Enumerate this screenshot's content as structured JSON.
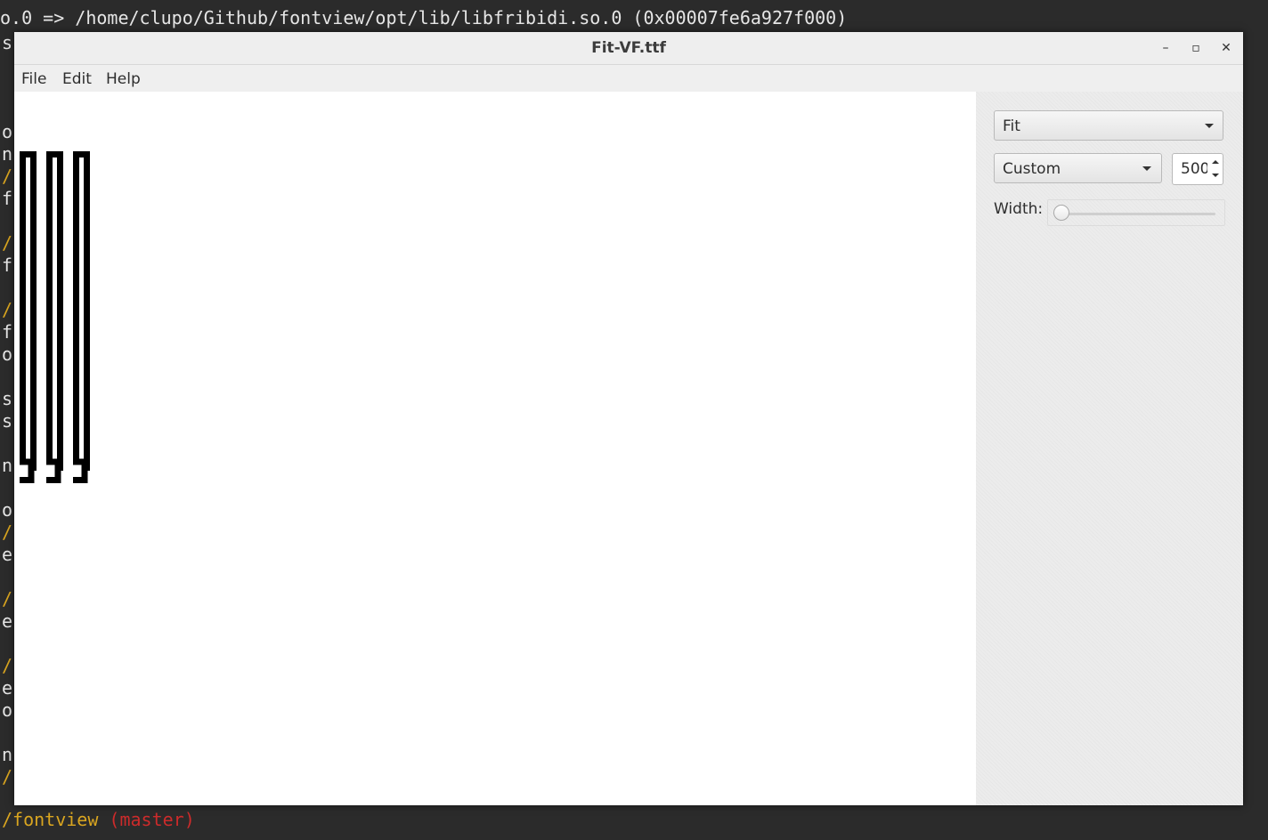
{
  "terminal": {
    "top_line": "o.0 => /home/clupo/Github/fontview/opt/lib/libfribidi.so.0 (0x00007fe6a927f000)",
    "left_fragments": [
      {
        "text": "s",
        "yellow": false
      },
      {
        "text": "o",
        "yellow": false
      },
      {
        "text": "n",
        "yellow": false
      },
      {
        "text": "/",
        "yellow": true
      },
      {
        "text": "f",
        "yellow": false
      },
      {
        "text": "/",
        "yellow": true
      },
      {
        "text": "f",
        "yellow": false
      },
      {
        "text": "/",
        "yellow": true
      },
      {
        "text": "f",
        "yellow": false
      },
      {
        "text": "o",
        "yellow": false
      },
      {
        "text": "s",
        "yellow": false
      },
      {
        "text": "s",
        "yellow": false
      },
      {
        "text": "n",
        "yellow": false
      },
      {
        "text": "o",
        "yellow": false
      },
      {
        "text": "/",
        "yellow": true
      },
      {
        "text": "e",
        "yellow": false
      },
      {
        "text": "/",
        "yellow": true
      },
      {
        "text": "e",
        "yellow": false
      },
      {
        "text": "/",
        "yellow": true
      },
      {
        "text": "e",
        "yellow": false
      },
      {
        "text": "o",
        "yellow": false
      },
      {
        "text": "n",
        "yellow": false
      },
      {
        "text": "/",
        "yellow": true
      }
    ],
    "prompt_path": "/fontview",
    "prompt_branch": "(master)"
  },
  "window": {
    "title": "Fit-VF.ttf",
    "buttons": {
      "minimize": "–",
      "maximize": "▫",
      "close": "✕"
    }
  },
  "menu": [
    "File",
    "Edit",
    "Help"
  ],
  "sidebar": {
    "font_select": "Fit",
    "instance_select": "Custom",
    "size_value": "500",
    "width_label": "Width:",
    "width_slider_fraction": 0.0
  },
  "colors": {
    "terminal_bg": "#2b2b2b",
    "terminal_text": "#e6e6e6",
    "terminal_yellow": "#d9a520",
    "terminal_red": "#cc2b2b"
  }
}
